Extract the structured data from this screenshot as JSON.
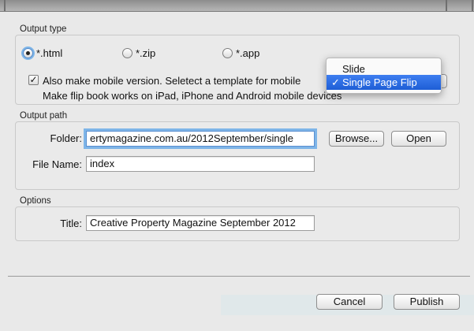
{
  "output_type": {
    "title": "Output type",
    "options": [
      "*.html",
      "*.zip",
      "*.app"
    ],
    "selected_index": 0,
    "mobile_checkbox": {
      "checked": true,
      "label": "Also make mobile version. Seletect a template for mobile",
      "description": "Make flip book works on iPad, iPhone and Android mobile devices"
    },
    "template_menu": {
      "options": [
        "Slide",
        "Single Page Flip"
      ],
      "selected": "Single Page Flip",
      "check_glyph": "✓"
    }
  },
  "output_path": {
    "title": "Output path",
    "folder_label": "Folder:",
    "folder_value": "ertymagazine.com.au/2012September/single",
    "browse_label": "Browse...",
    "open_label": "Open",
    "file_name_label": "File Name:",
    "file_name_value": "index"
  },
  "options": {
    "title": "Options",
    "title_label": "Title:",
    "title_value": "Creative Property Magazine September 2012"
  },
  "footer": {
    "cancel_label": "Cancel",
    "publish_label": "Publish"
  },
  "colors": {
    "focus_ring": "#7eb5e8",
    "menu_highlight": "#2b6ae3"
  }
}
